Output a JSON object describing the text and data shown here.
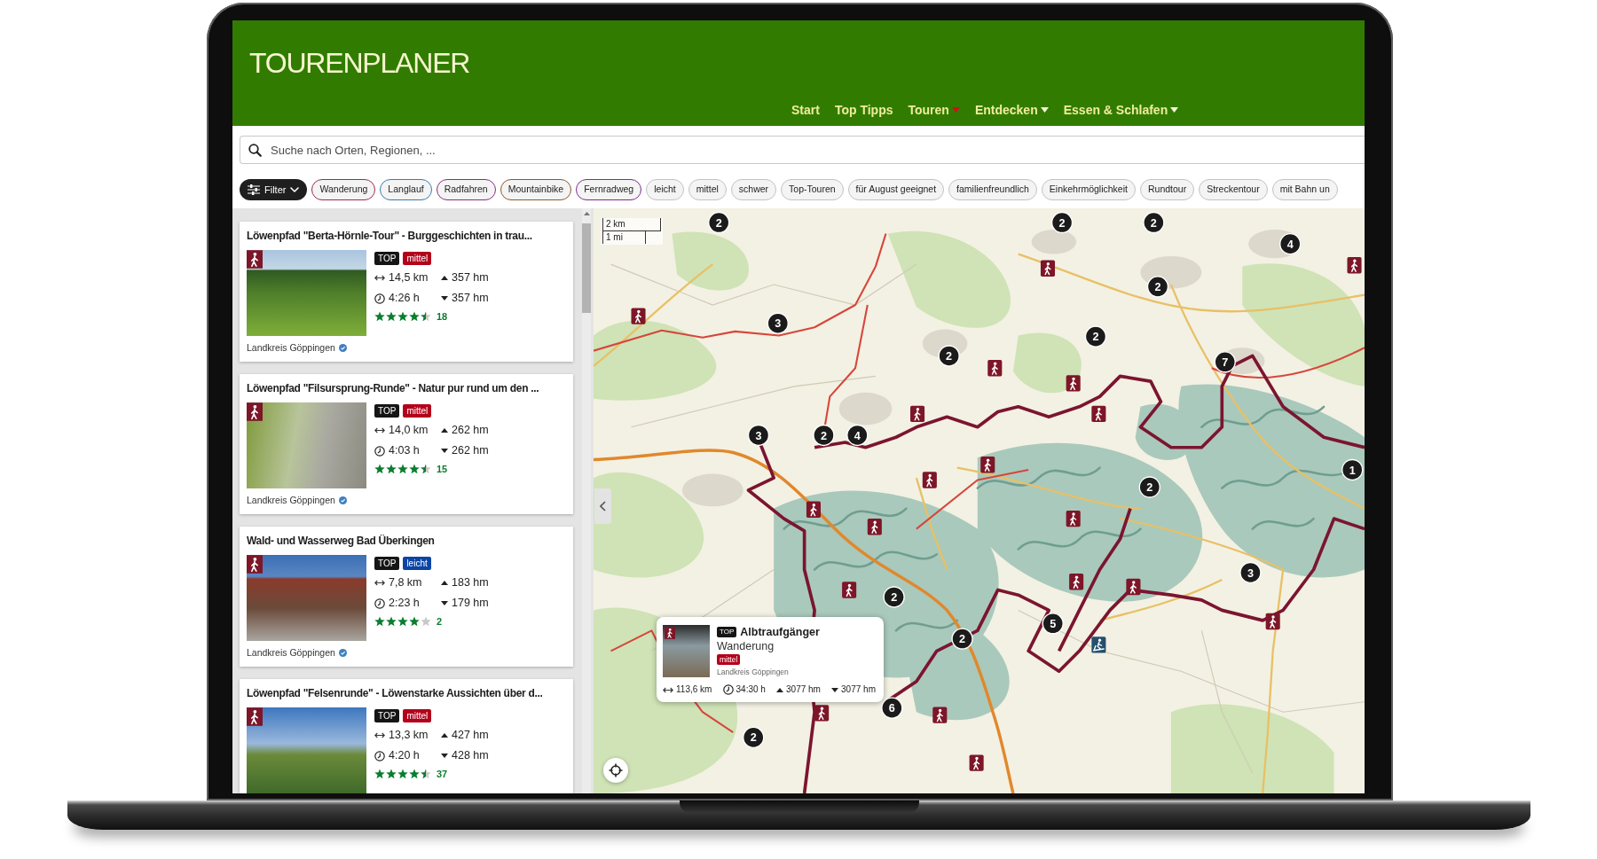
{
  "header": {
    "title": "TOURENPLANER",
    "nav": [
      {
        "label": "Start",
        "dropdown": false,
        "selected": false
      },
      {
        "label": "Top Tipps",
        "dropdown": false,
        "selected": false
      },
      {
        "label": "Touren",
        "dropdown": true,
        "selected": true
      },
      {
        "label": "Entdecken",
        "dropdown": true,
        "selected": false
      },
      {
        "label": "Essen & Schlafen",
        "dropdown": true,
        "selected": false
      }
    ]
  },
  "search": {
    "placeholder": "Suche nach Orten, Regionen, ..."
  },
  "filters": {
    "button": "Filter",
    "chips": [
      {
        "label": "Wanderung",
        "color": "#9b2b55"
      },
      {
        "label": "Langlauf",
        "color": "#3a7ab0"
      },
      {
        "label": "Radfahren",
        "color": "#8a2d80"
      },
      {
        "label": "Mountainbike",
        "color": "#8b5a2b"
      },
      {
        "label": "Fernradweg",
        "color": "#7a2f8f"
      },
      {
        "label": "leicht",
        "color": "#c2c2c2"
      },
      {
        "label": "mittel",
        "color": "#c2c2c2"
      },
      {
        "label": "schwer",
        "color": "#c2c2c2"
      },
      {
        "label": "Top-Touren",
        "color": "#c2c2c2"
      },
      {
        "label": "für August geeignet",
        "color": "#c2c2c2"
      },
      {
        "label": "familienfreundlich",
        "color": "#c2c2c2"
      },
      {
        "label": "Einkehrmöglichkeit",
        "color": "#c2c2c2"
      },
      {
        "label": "Rundtour",
        "color": "#c2c2c2"
      },
      {
        "label": "Streckentour",
        "color": "#c2c2c2"
      },
      {
        "label": "mit Bahn un",
        "color": "#c2c2c2"
      }
    ]
  },
  "tours": [
    {
      "title": "Löwenpfad \"Berta-Hörnle-Tour\" - Burggeschichten in trau...",
      "badges": [
        {
          "label": "TOP",
          "color": "#151515"
        },
        {
          "label": "mittel",
          "color": "#b3001b"
        }
      ],
      "distance": "14,5 km",
      "duration": "4:26 h",
      "ascent": "357 hm",
      "descent": "357 hm",
      "stars": 4.5,
      "rating_count": "18",
      "source": "Landkreis Göppingen"
    },
    {
      "title": "Löwenpfad \"Filsursprung-Runde\" - Natur pur rund um den ...",
      "badges": [
        {
          "label": "TOP",
          "color": "#151515"
        },
        {
          "label": "mittel",
          "color": "#b3001b"
        }
      ],
      "distance": "14,0 km",
      "duration": "4:03 h",
      "ascent": "262 hm",
      "descent": "262 hm",
      "stars": 4.5,
      "rating_count": "15",
      "source": "Landkreis Göppingen"
    },
    {
      "title": "Wald- und Wasserweg Bad Überkingen",
      "badges": [
        {
          "label": "TOP",
          "color": "#151515"
        },
        {
          "label": "leicht",
          "color": "#0a45a5"
        }
      ],
      "distance": "7,8 km",
      "duration": "2:23 h",
      "ascent": "183 hm",
      "descent": "179 hm",
      "stars": 4,
      "rating_count": "2",
      "source": "Landkreis Göppingen"
    },
    {
      "title": "Löwenpfad \"Felsenrunde\" - Löwenstarke Aussichten über d...",
      "badges": [
        {
          "label": "TOP",
          "color": "#151515"
        },
        {
          "label": "mittel",
          "color": "#b3001b"
        }
      ],
      "distance": "13,3 km",
      "duration": "4:20 h",
      "ascent": "427 hm",
      "descent": "428 hm",
      "stars": 4.5,
      "rating_count": "37"
    }
  ],
  "map": {
    "scale": {
      "metric": "2 km",
      "imperial": "1 mi"
    },
    "clusters": [
      {
        "count": "2"
      },
      {
        "count": "2"
      },
      {
        "count": "2"
      },
      {
        "count": "4"
      },
      {
        "count": "2"
      },
      {
        "count": "3"
      },
      {
        "count": "2"
      },
      {
        "count": "2"
      },
      {
        "count": "7"
      },
      {
        "count": "3"
      },
      {
        "count": "2"
      },
      {
        "count": "4"
      },
      {
        "count": "1"
      },
      {
        "count": "2"
      },
      {
        "count": "3"
      },
      {
        "count": "2"
      },
      {
        "count": "5"
      },
      {
        "count": "2"
      },
      {
        "count": "6"
      },
      {
        "count": "2"
      }
    ],
    "popup": {
      "badge": "TOP",
      "title": "Albtraufgänger",
      "category": "Wanderung",
      "difficulty": {
        "label": "mittel",
        "color": "#b3001b"
      },
      "source": "Landkreis Göppingen",
      "distance": "113,6 km",
      "duration": "34:30 h",
      "ascent": "3077 hm",
      "descent": "3077 hm"
    }
  }
}
